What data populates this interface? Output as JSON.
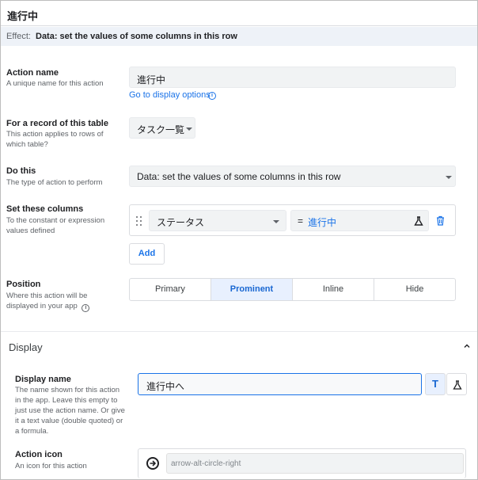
{
  "title": "進行中",
  "effect": {
    "label": "Effect:",
    "value": "Data: set the values of some columns in this row"
  },
  "action_name": {
    "label": "Action name",
    "hint": "A unique name for this action",
    "value": "進行中",
    "link": "Go to display options",
    "link_icon": "info-icon"
  },
  "record_table": {
    "label": "For a record of this table",
    "hint": "This action applies to rows of which table?",
    "value": "タスク一覧"
  },
  "do_this": {
    "label": "Do this",
    "hint": "The type of action to perform",
    "value": "Data: set the values of some columns in this row"
  },
  "set_columns": {
    "label": "Set these columns",
    "hint": "To the constant or expression values defined",
    "column": "ステータス",
    "eq": "=",
    "expression": "進行中",
    "add_label": "Add"
  },
  "position": {
    "label": "Position",
    "hint": "Where this action will be displayed in your app",
    "options": [
      "Primary",
      "Prominent",
      "Inline",
      "Hide"
    ],
    "selected": "Prominent"
  },
  "display": {
    "section_title": "Display",
    "display_name": {
      "label": "Display name",
      "hint": "The name shown for this action in the app. Leave this empty to just use the action name. Or give it a text value (double quoted) or a formula.",
      "value": "進行中へ",
      "text_mode_label": "T"
    },
    "action_icon": {
      "label": "Action icon",
      "hint": "An icon for this action",
      "value": "arrow-alt-circle-right"
    }
  },
  "colors": {
    "accent": "#1a73e8",
    "selected_bg": "#e8f0fe",
    "effect_bg": "#eef2f8"
  }
}
